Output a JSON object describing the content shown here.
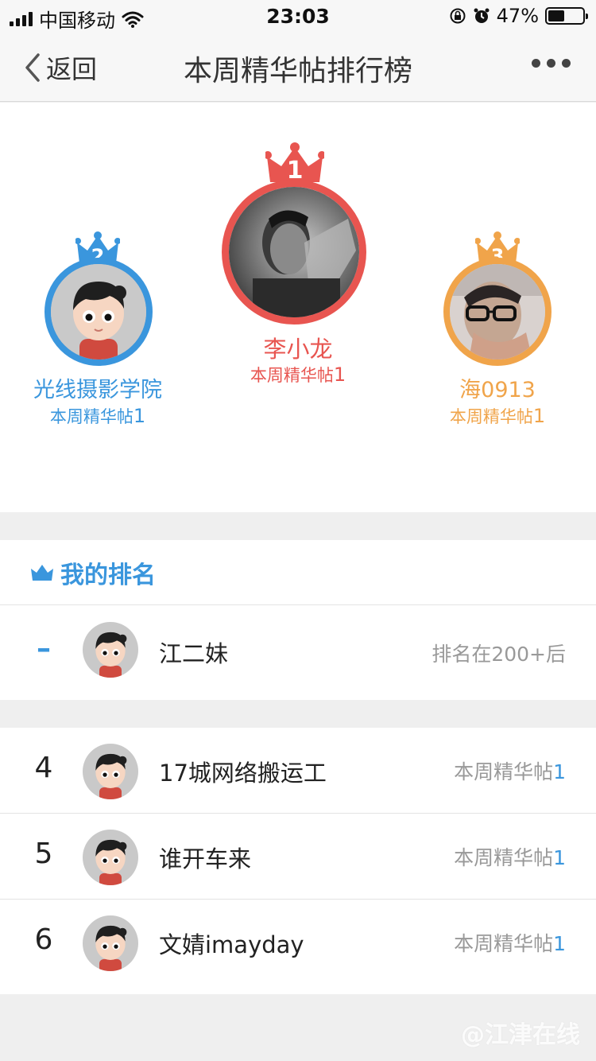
{
  "status_bar": {
    "carrier": "中国移动",
    "time": "23:03",
    "battery": "47%",
    "battery_level": 0.47
  },
  "nav": {
    "back_label": "返回",
    "title": "本周精华帖排行榜"
  },
  "podium": [
    {
      "rank": "1",
      "name": "李小龙",
      "stat_label": "本周精华帖",
      "stat_value": "1",
      "color": "#e85550"
    },
    {
      "rank": "2",
      "name": "光线摄影学院",
      "stat_label": "本周精华帖",
      "stat_value": "1",
      "color": "#3a96dd"
    },
    {
      "rank": "3",
      "name": "海0913",
      "stat_label": "本周精华帖",
      "stat_value": "1",
      "color": "#f0a44a"
    }
  ],
  "my_rank": {
    "header": "我的排名",
    "rank": "–",
    "name": "江二妹",
    "status": "排名在200+后"
  },
  "list": [
    {
      "rank": "4",
      "name": "17城网络搬运工",
      "stat_label": "本周精华帖",
      "stat_value": "1"
    },
    {
      "rank": "5",
      "name": "谁开车来",
      "stat_label": "本周精华帖",
      "stat_value": "1"
    },
    {
      "rank": "6",
      "name": "文婧imayday",
      "stat_label": "本周精华帖",
      "stat_value": "1"
    }
  ],
  "watermark": "@江津在线"
}
